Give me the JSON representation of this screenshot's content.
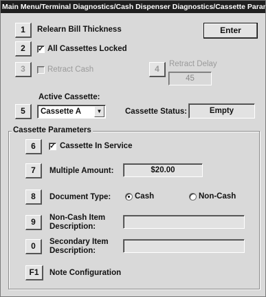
{
  "window": {
    "title": "Main Menu/Terminal Diagnostics/Cash Dispenser Diagnostics/Cassette Parameters"
  },
  "enter_button": {
    "label": "Enter"
  },
  "rows": {
    "relearn": {
      "key": "1",
      "label": "Relearn Bill Thickness"
    },
    "cassettes_locked": {
      "key": "2",
      "label": "All Cassettes Locked",
      "checked": true,
      "mark": "✓"
    },
    "retract_cash": {
      "key": "3",
      "label": "Retract Cash",
      "checked": false,
      "disabled": true
    },
    "retract_delay": {
      "key": "4",
      "label": "Retract Delay",
      "value": "45",
      "disabled": true
    },
    "active_cassette": {
      "key": "5",
      "label": "Active Cassette:",
      "selected": "Cassette A",
      "arrow": "▼"
    },
    "cassette_status": {
      "label": "Cassette Status:",
      "value": "Empty"
    }
  },
  "cassette_parameters": {
    "title": "Cassette Parameters",
    "in_service": {
      "key": "6",
      "label": "Cassette In Service",
      "checked": true,
      "mark": "✓"
    },
    "multiple_amount": {
      "key": "7",
      "label": "Multiple Amount:",
      "value": "$20.00"
    },
    "document_type": {
      "key": "8",
      "label": "Document Type:",
      "options": [
        {
          "label": "Cash",
          "selected": true
        },
        {
          "label": "Non-Cash",
          "selected": false
        }
      ]
    },
    "non_cash_description": {
      "key": "9",
      "label": "Non-Cash Item Description:",
      "value": ""
    },
    "secondary_description": {
      "key": "0",
      "label": "Secondary Item Description:",
      "value": ""
    },
    "note_configuration": {
      "key": "F1",
      "label": "Note Configuration"
    }
  },
  "colors": {
    "titlebar": "#1f1f1f",
    "panel": "#d9d9d9",
    "disabled_text": "#9a9a9a"
  }
}
